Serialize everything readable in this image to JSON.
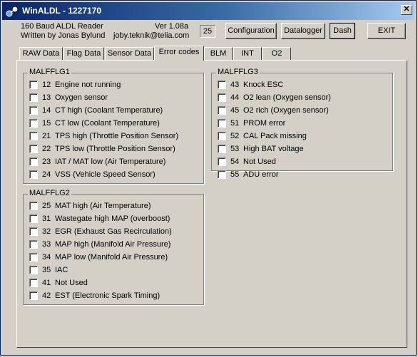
{
  "window": {
    "title": "WinALDL - 1227170",
    "close_glyph": "✕"
  },
  "header": {
    "app_name": "160 Baud ALDL Reader",
    "author": "Written by Jonas Bylund",
    "version": "Ver 1.08a",
    "email": "joby.teknik@telia.com",
    "counter": "25"
  },
  "buttons": {
    "configuration": "Configuration",
    "datalogger": "Datalogger",
    "dash": "Dash",
    "exit": "EXIT"
  },
  "tabs": [
    "RAW Data",
    "Flag Data",
    "Sensor Data",
    "Error codes",
    "BLM",
    "INT",
    "O2"
  ],
  "active_tab": "Error codes",
  "groups": {
    "malfflg1": {
      "title": "MALFFLG1",
      "items": [
        {
          "code": "12",
          "label": "Engine not running",
          "checked": false
        },
        {
          "code": "13",
          "label": "Oxygen sensor",
          "checked": false
        },
        {
          "code": "14",
          "label": "CT high (Coolant Temperature)",
          "checked": false
        },
        {
          "code": "15",
          "label": "CT low (Coolant Temperature)",
          "checked": false
        },
        {
          "code": "21",
          "label": "TPS high (Throttle Position Sensor)",
          "checked": false
        },
        {
          "code": "22",
          "label": "TPS low (Throttle Position Sensor)",
          "checked": false
        },
        {
          "code": "23",
          "label": "IAT / MAT low (Air Temperature)",
          "checked": false
        },
        {
          "code": "24",
          "label": "VSS (Vehicle Speed Sensor)",
          "checked": false
        }
      ]
    },
    "malfflg2": {
      "title": "MALFFLG2",
      "items": [
        {
          "code": "25",
          "label": "MAT high (Air Temperature)",
          "checked": false
        },
        {
          "code": "31",
          "label": "Wastegate high MAP (overboost)",
          "checked": false
        },
        {
          "code": "32",
          "label": "EGR (Exhaust Gas Recirculation)",
          "checked": false
        },
        {
          "code": "33",
          "label": "MAP high (Manifold Air Pressure)",
          "checked": false
        },
        {
          "code": "34",
          "label": "MAP low (Manifold Air Pressure)",
          "checked": false
        },
        {
          "code": "35",
          "label": "IAC",
          "checked": false
        },
        {
          "code": "41",
          "label": "Not Used",
          "checked": false
        },
        {
          "code": "42",
          "label": "EST (Electronic Spark Timing)",
          "checked": false
        }
      ]
    },
    "malfflg3": {
      "title": "MALFFLG3",
      "items": [
        {
          "code": "43",
          "label": "Knock ESC",
          "checked": false
        },
        {
          "code": "44",
          "label": "O2 lean (Oxygen sensor)",
          "checked": false
        },
        {
          "code": "45",
          "label": "O2 rich (Oxygen sensor)",
          "checked": false
        },
        {
          "code": "51",
          "label": "PROM error",
          "checked": false
        },
        {
          "code": "52",
          "label": "CAL Pack missing",
          "checked": false
        },
        {
          "code": "53",
          "label": "High BAT voltage",
          "checked": false
        },
        {
          "code": "54",
          "label": "Not Used",
          "checked": false
        },
        {
          "code": "55",
          "label": "ADU error",
          "checked": false
        }
      ]
    }
  }
}
